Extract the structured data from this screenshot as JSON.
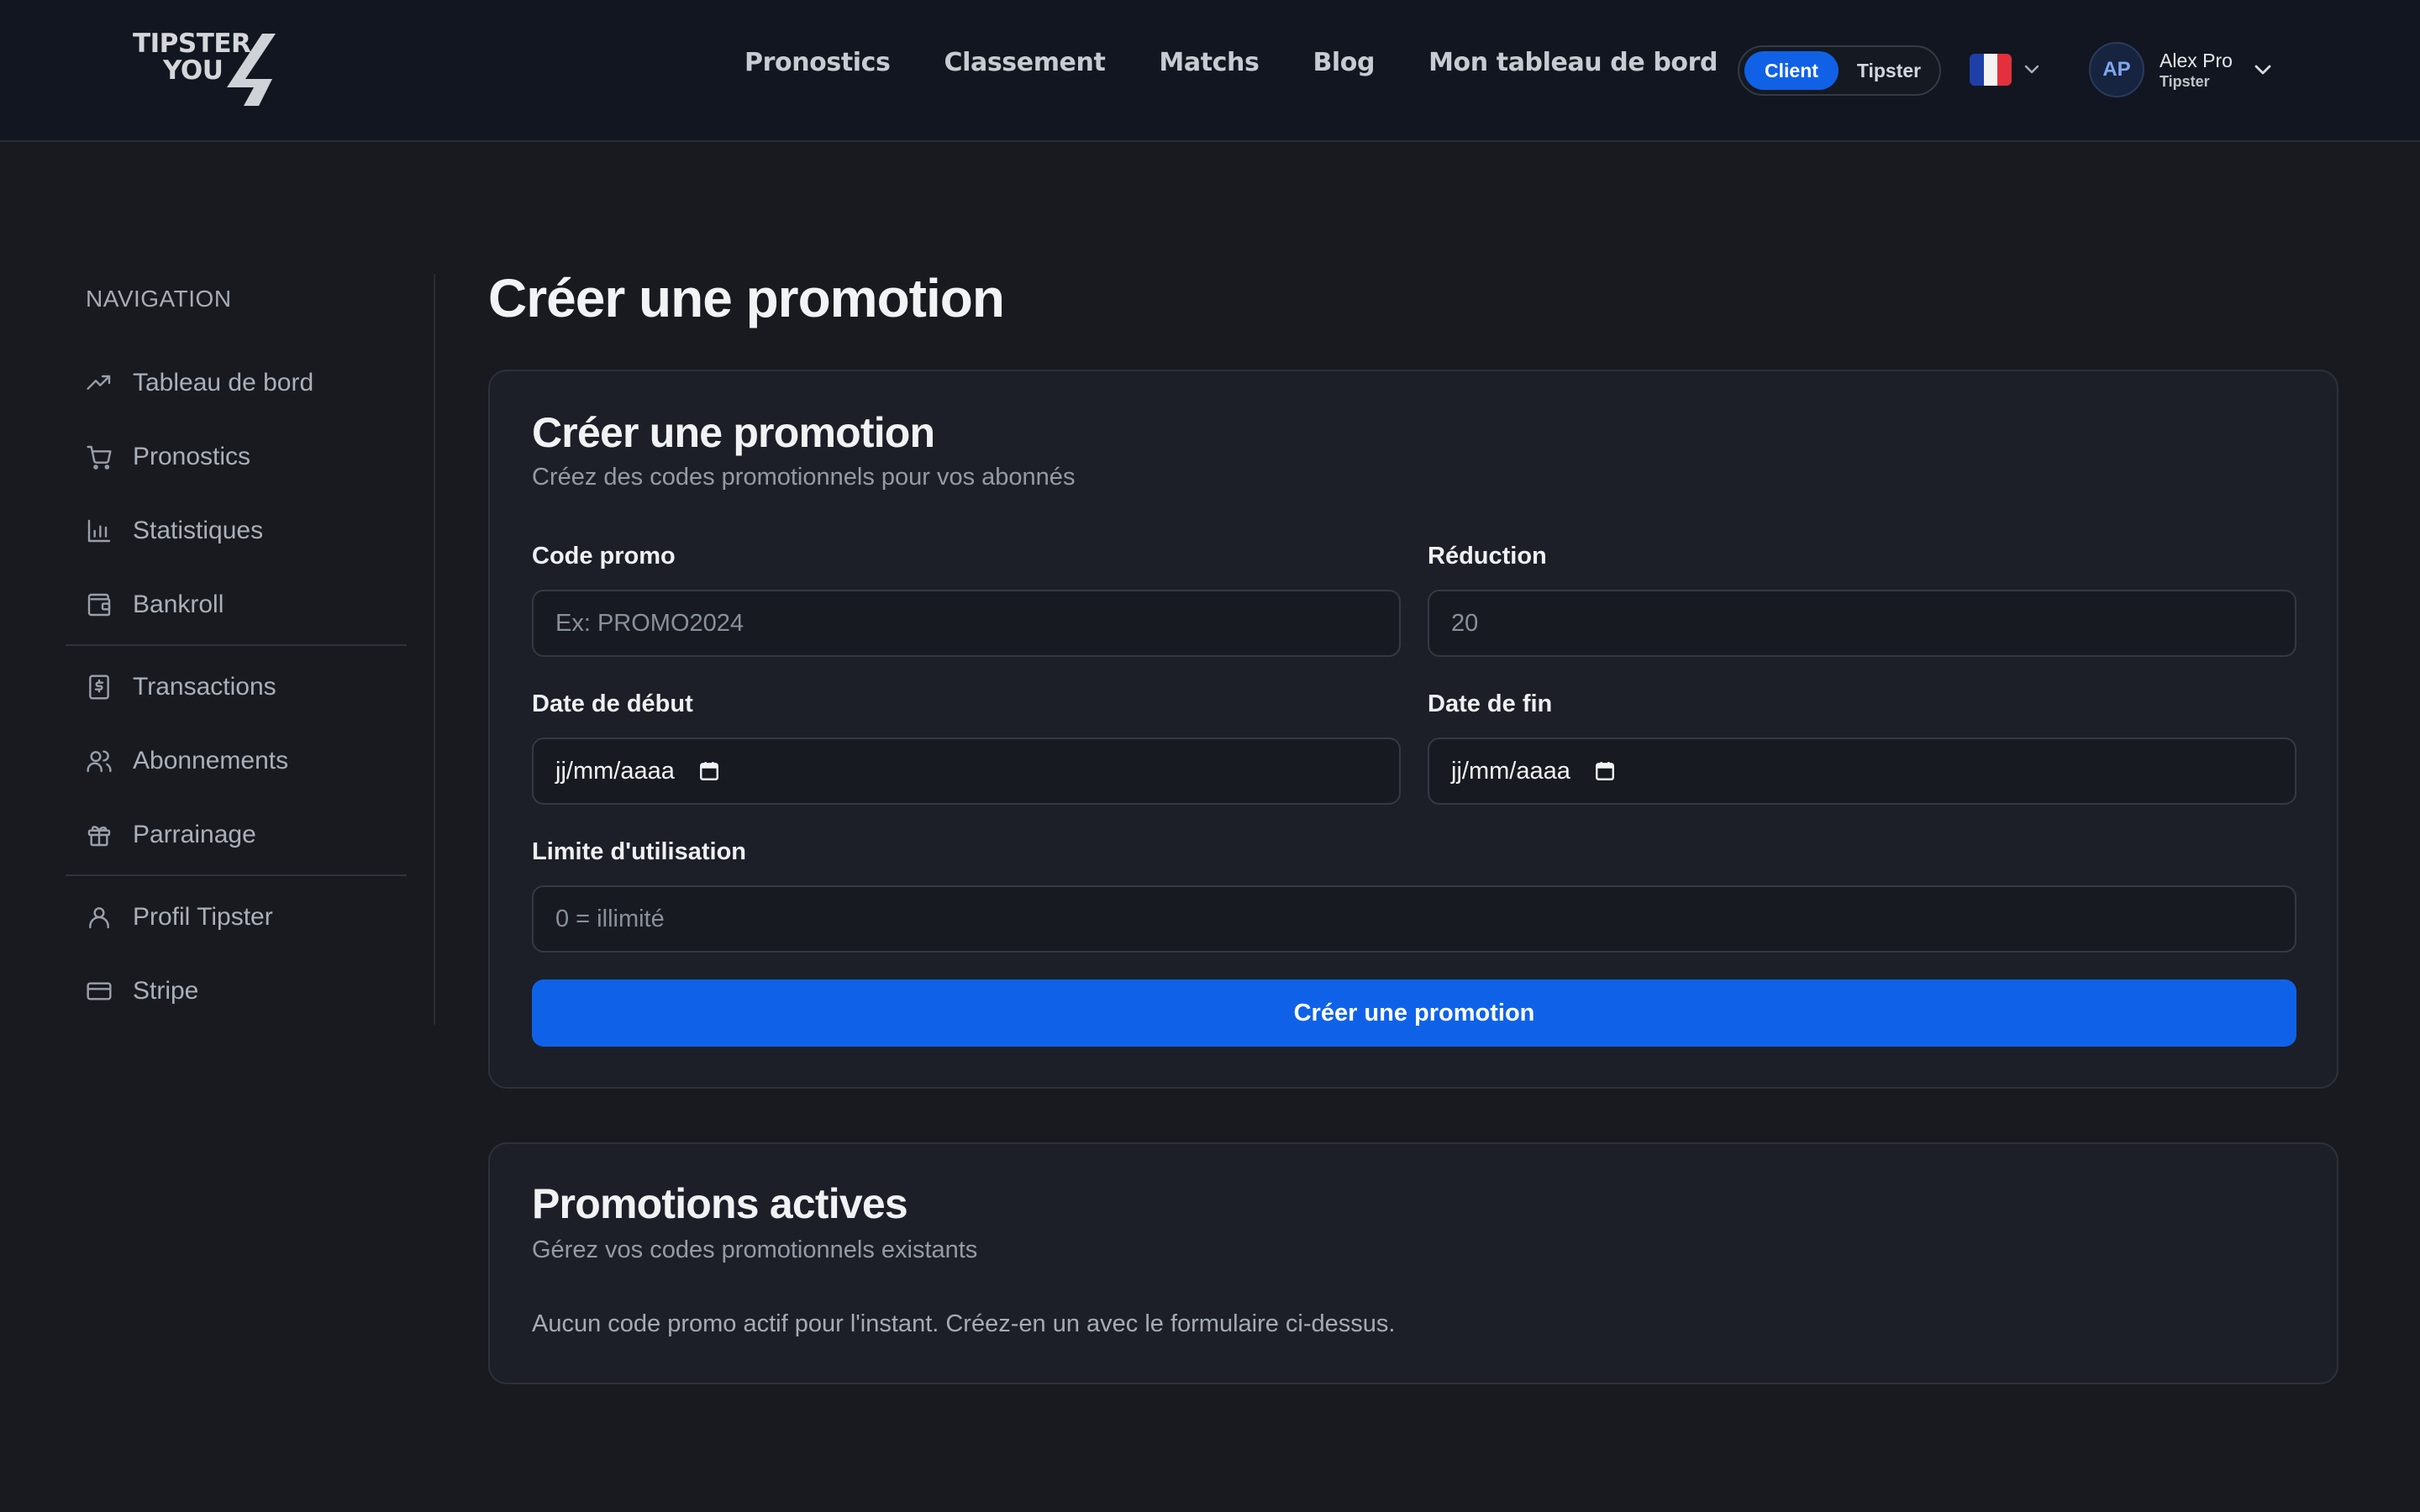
{
  "header": {
    "logo": {
      "line1": "TIPSTER",
      "line2": "YOU"
    },
    "nav": [
      "Pronostics",
      "Classement",
      "Matchs",
      "Blog",
      "Mon tableau de bord"
    ],
    "mode_toggle": {
      "active": "Client",
      "inactive": "Tipster"
    },
    "language": {
      "flag": "fr-flag",
      "icon": "chevron-down-icon"
    },
    "user": {
      "initials": "AP",
      "name": "Alex Pro",
      "role": "Tipster"
    }
  },
  "sidebar": {
    "title": "NAVIGATION",
    "items": [
      {
        "label": "Tableau de bord",
        "icon": "trending-up-icon"
      },
      {
        "label": "Pronostics",
        "icon": "cart-icon"
      },
      {
        "label": "Statistiques",
        "icon": "bar-chart-icon"
      },
      {
        "label": "Bankroll",
        "icon": "wallet-icon"
      },
      {
        "label": "Transactions",
        "icon": "receipt-dollar-icon"
      },
      {
        "label": "Abonnements",
        "icon": "users-icon"
      },
      {
        "label": "Parrainage",
        "icon": "gift-icon"
      },
      {
        "label": "Profil Tipster",
        "icon": "user-icon"
      },
      {
        "label": "Stripe",
        "icon": "credit-card-icon"
      }
    ]
  },
  "main": {
    "page_title": "Créer une promotion",
    "create_card": {
      "title": "Créer une promotion",
      "subtitle": "Créez des codes promotionnels pour vos abonnés",
      "code_label": "Code promo",
      "code_placeholder": "Ex: PROMO2024",
      "reduction_label": "Réduction",
      "reduction_placeholder": "20",
      "start_label": "Date de début",
      "start_value": "jj/mm/aaaa",
      "end_label": "Date de fin",
      "end_value": "jj/mm/aaaa",
      "limit_label": "Limite d'utilisation",
      "limit_placeholder": "0 = illimité",
      "submit_label": "Créer une promotion"
    },
    "active_card": {
      "title": "Promotions actives",
      "subtitle": "Gérez vos codes promotionnels existants",
      "empty_message": "Aucun code promo actif pour l'instant. Créez-en un avec le formulaire ci-dessus."
    }
  },
  "colors": {
    "background": "#181a20",
    "header_bg": "#111620",
    "card_bg": "#1c1f27",
    "accent": "#0f62e8"
  }
}
